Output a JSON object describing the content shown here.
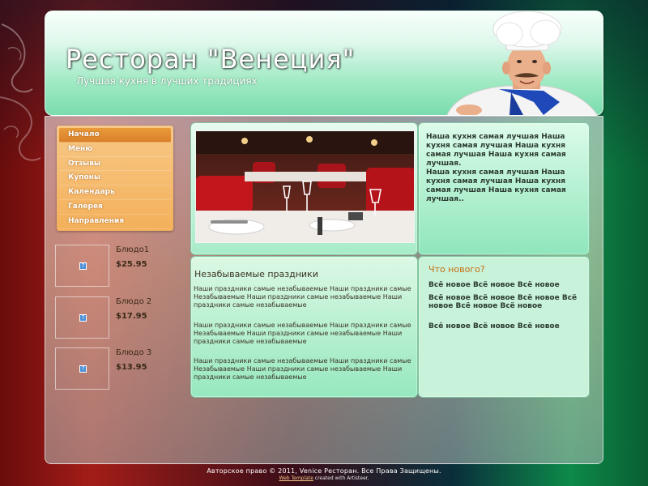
{
  "header": {
    "title": "Ресторан \"Венеция\"",
    "slogan": "Лучшая кухня в лучших традициях"
  },
  "menu": {
    "items": [
      {
        "label": "Начало",
        "active": true
      },
      {
        "label": "Меню"
      },
      {
        "label": "Отзывы"
      },
      {
        "label": "Купоны"
      },
      {
        "label": "Календарь"
      },
      {
        "label": "Галерея"
      },
      {
        "label": "Направления"
      }
    ]
  },
  "products": [
    {
      "name": "Блюдо1",
      "price": "$25.95"
    },
    {
      "name": "Блюдо 2",
      "price": "$17.95"
    },
    {
      "name": "Блюдо 3",
      "price": "$13.95"
    }
  ],
  "intro": {
    "para1": "Наша кухня самая лучшая Наша кухня самая лучшая Наша кухня самая лучшая Наша кухня самая лучшая.",
    "para2": "Наша кухня самая лучшая Наша кухня самая лучшая Наша кухня самая лучшая Наша кухня самая лучшая.."
  },
  "article": {
    "title": "Незабываемые праздники",
    "paragraphs": [
      "Наши праздники самые незабываемые Наши праздники самые Незабываемые Наши праздники самые незабываемые Наши праздники самые незабываемые",
      "Наши праздники самые незабываемые Наши праздники самые Незабываемые Наши праздники самые незабываемые Наши праздники самые незабываемые",
      "Наши праздники самые незабываемые Наши праздники самые Незабываемые Наши праздники самые незабываемые Наши праздники самые незабываемые"
    ]
  },
  "news": {
    "title": "Что нового?",
    "lines": [
      "Всё новое Всё новое Всё новое",
      "Всё новое Всё новое Всё новое Всё новое Всё новое Всё новое",
      "Всё новое Всё новое Всё новое"
    ]
  },
  "footer": {
    "copyright": "Авторское право © 2011, Venice Ресторан. Все Права Защищены.",
    "credit_link": "Web Template",
    "credit_text": " created with Artisteer."
  },
  "colors": {
    "accent": "#f4b05a",
    "header_green": "#7bdcae",
    "news_title": "#c66f12"
  },
  "icons": {
    "product_placeholder": "broken-image-icon"
  }
}
